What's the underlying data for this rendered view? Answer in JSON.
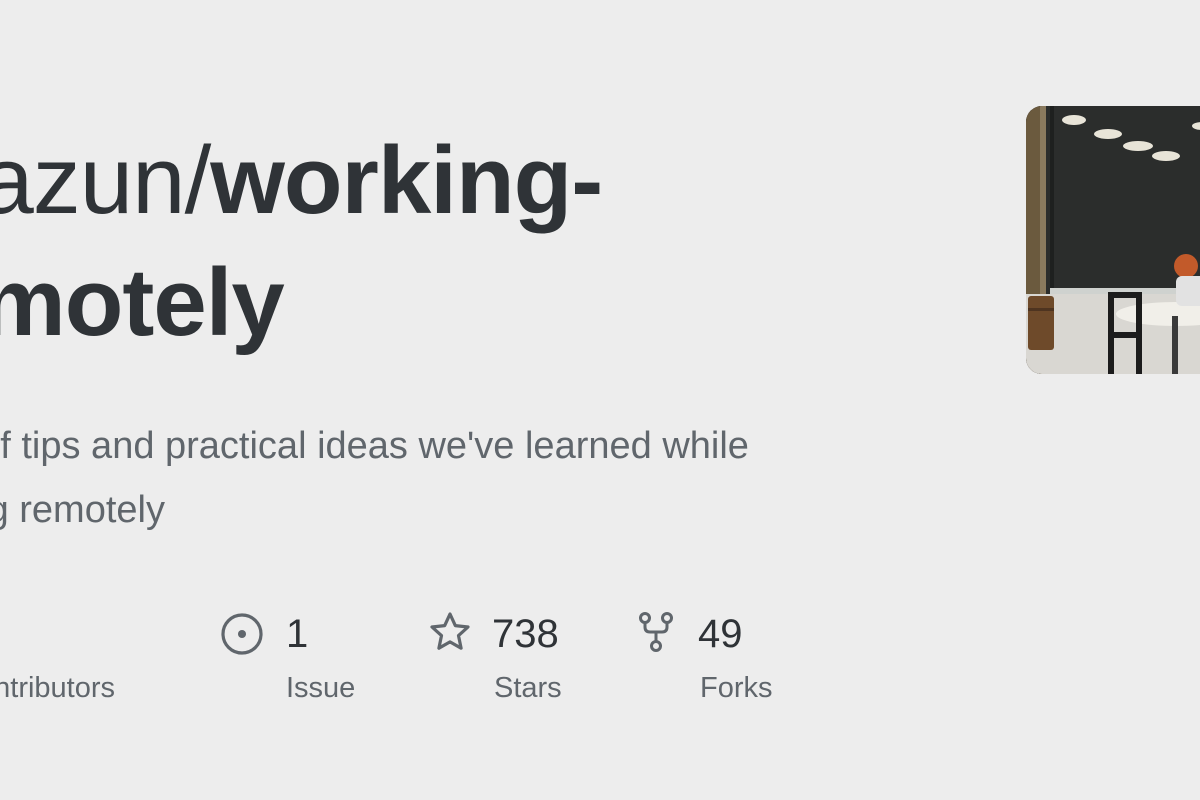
{
  "repo": {
    "owner": "nazun",
    "separator": "/",
    "name_line1": "working-",
    "name_line2": "emotely"
  },
  "description": {
    "line1": "t of tips and practical ideas we've learned while",
    "line2": "ing remotely"
  },
  "stats": {
    "contributors": {
      "label": "ontributors"
    },
    "issues": {
      "count": "1",
      "label": "Issue",
      "icon": "issue-opened-icon"
    },
    "stars": {
      "count": "738",
      "label": "Stars",
      "icon": "star-icon"
    },
    "forks": {
      "count": "49",
      "label": "Forks",
      "icon": "repo-forked-icon"
    }
  },
  "colors": {
    "background": "#ededed",
    "title": "#2f3337",
    "muted": "#60666c"
  }
}
